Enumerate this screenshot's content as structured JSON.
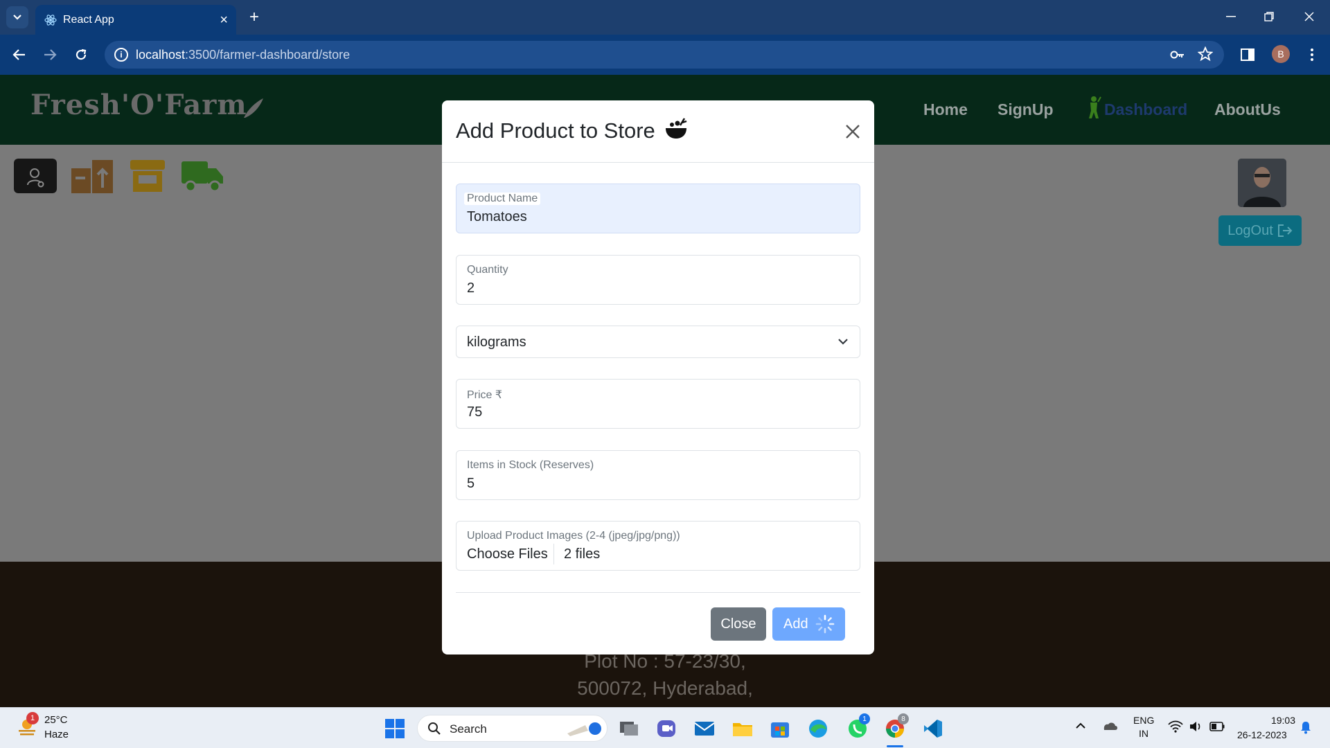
{
  "browser": {
    "tab_title": "React App",
    "url_host": "localhost",
    "url_path": ":3500/farmer-dashboard/store",
    "profile_initial": "B"
  },
  "site": {
    "logo_text": "Fresh'O'Farm",
    "nav": [
      "Home",
      "SignUp",
      "Dashboard",
      "AboutUs"
    ],
    "logout_label": "LogOut",
    "footer_line1": "Plot No : 57-23/30,",
    "footer_line2": "500072, Hyderabad,"
  },
  "modal": {
    "title": "Add Product to Store",
    "fields": [
      {
        "label": "Product Name",
        "value": "Tomatoes"
      },
      {
        "label": "Quantity",
        "value": "2"
      },
      {
        "label": "Price ₹",
        "value": "75"
      },
      {
        "label": "Items in Stock (Reserves)",
        "value": "5"
      }
    ],
    "unit_select": "kilograms",
    "upload": {
      "label": "Upload Product Images (2-4 (jpeg/jpg/png))",
      "button": "Choose Files",
      "status": "2 files"
    },
    "close_label": "Close",
    "add_label": "Add"
  },
  "taskbar": {
    "weather_temp": "25°C",
    "weather_desc": "Haze",
    "weather_badge": "1",
    "search_placeholder": "Search",
    "whatsapp_badge": "1",
    "chrome_badge": "8",
    "lang_line1": "ENG",
    "lang_line2": "IN",
    "time": "19:03",
    "date": "26-12-2023"
  },
  "colors": {
    "accent": "#0d6efd",
    "add_button": "#6ea8fe",
    "close_button": "#6c757d",
    "nav_bg": "#062818",
    "footer_bg": "#1b130c"
  }
}
